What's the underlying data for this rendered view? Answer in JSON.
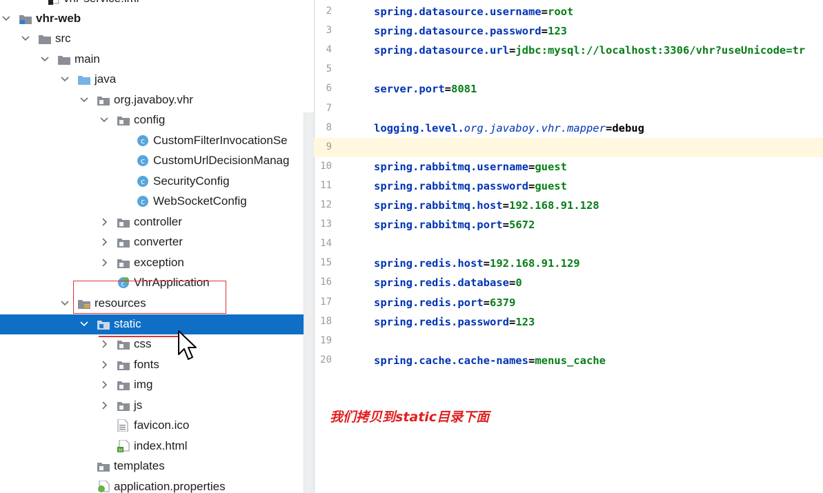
{
  "tree": {
    "rows": [
      {
        "label": "vhr-service.iml",
        "bold": false
      },
      {
        "label": "vhr-web",
        "bold": true
      },
      {
        "label": "src"
      },
      {
        "label": "main"
      },
      {
        "label": "java"
      },
      {
        "label": "org.javaboy.vhr"
      },
      {
        "label": "config"
      },
      {
        "label": "CustomFilterInvocationSe"
      },
      {
        "label": "CustomUrlDecisionManag"
      },
      {
        "label": "SecurityConfig"
      },
      {
        "label": "WebSocketConfig"
      },
      {
        "label": "controller"
      },
      {
        "label": "converter"
      },
      {
        "label": "exception"
      },
      {
        "label": "VhrApplication"
      },
      {
        "label": "resources"
      },
      {
        "label": "static"
      },
      {
        "label": "css"
      },
      {
        "label": "fonts"
      },
      {
        "label": "img"
      },
      {
        "label": "js"
      },
      {
        "label": "favicon.ico"
      },
      {
        "label": "index.html"
      },
      {
        "label": "templates"
      },
      {
        "label": "application.properties"
      }
    ]
  },
  "editor": {
    "lines": [
      {
        "num": "2",
        "key": "spring.datasource.username",
        "value": "root"
      },
      {
        "num": "3",
        "key": "spring.datasource.password",
        "value": "123"
      },
      {
        "num": "4",
        "key": "spring.datasource.url",
        "value": "jdbc:mysql://localhost:3306/vhr?useUnicode=tr"
      },
      {
        "num": "5",
        "key": "",
        "value": ""
      },
      {
        "num": "6",
        "key": "server.port",
        "value": "8081"
      },
      {
        "num": "7",
        "key": "",
        "value": ""
      },
      {
        "num": "8",
        "key_prefix": "logging.level.",
        "key_italic": "org.javaboy.vhr.mapper",
        "value": "debug"
      },
      {
        "num": "9",
        "key": "",
        "value": ""
      },
      {
        "num": "10",
        "key": "spring.rabbitmq.username",
        "value": "guest"
      },
      {
        "num": "11",
        "key": "spring.rabbitmq.password",
        "value": "guest"
      },
      {
        "num": "12",
        "key": "spring.rabbitmq.host",
        "value": "192.168.91.128"
      },
      {
        "num": "13",
        "key": "spring.rabbitmq.port",
        "value": "5672"
      },
      {
        "num": "14",
        "key": "",
        "value": ""
      },
      {
        "num": "15",
        "key": "spring.redis.host",
        "value": "192.168.91.129"
      },
      {
        "num": "16",
        "key": "spring.redis.database",
        "value": "0"
      },
      {
        "num": "17",
        "key": "spring.redis.port",
        "value": "6379"
      },
      {
        "num": "18",
        "key": "spring.redis.password",
        "value": "123"
      },
      {
        "num": "19",
        "key": "",
        "value": ""
      },
      {
        "num": "20",
        "key": "spring.cache.cache-names",
        "value": "menus_cache"
      }
    ],
    "current_line": "9"
  },
  "annotation": {
    "note": "我们拷贝到static目录下面"
  },
  "colors": {
    "selection": "#0f6fc6",
    "key": "#0033b3",
    "value": "#067d17",
    "annotation": "#e03030",
    "current_line": "#fff8df"
  }
}
